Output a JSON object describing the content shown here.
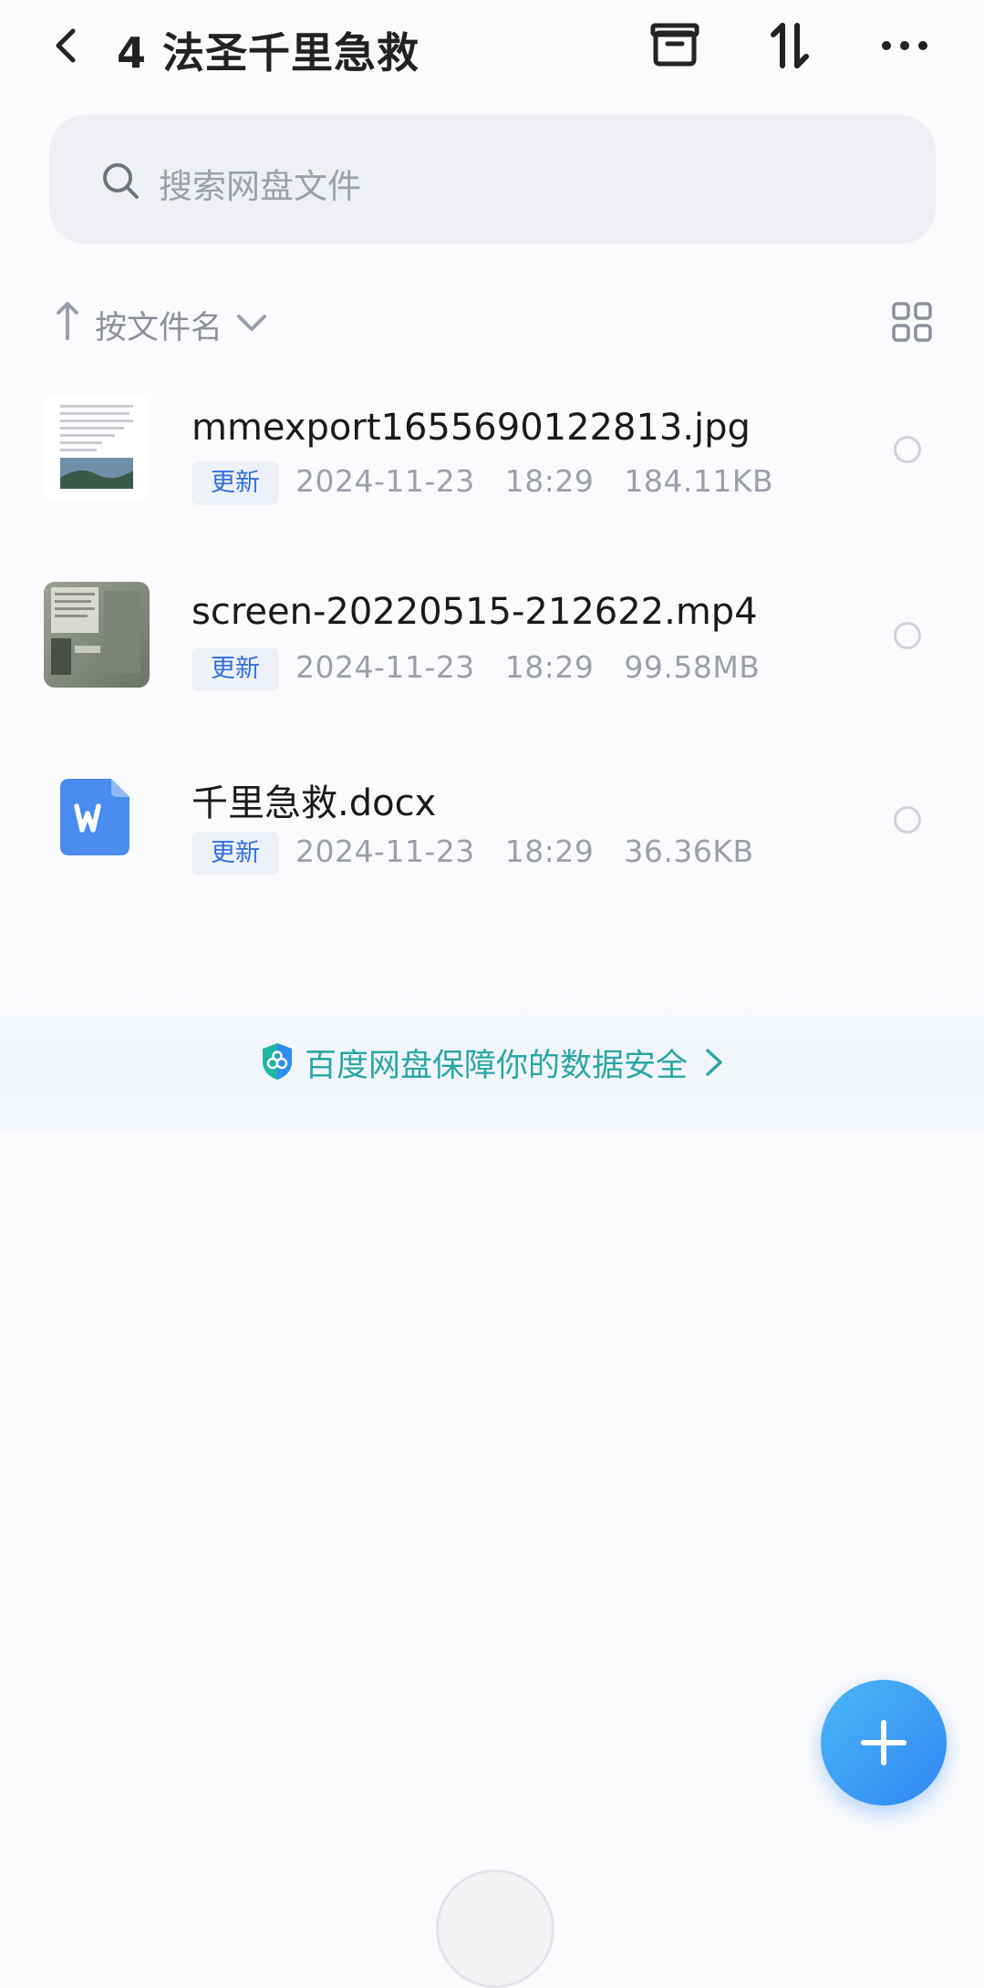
{
  "header": {
    "title": "4 法圣千里急救",
    "icons": [
      "back-icon",
      "archive-icon",
      "sort-icon",
      "more-icon"
    ]
  },
  "search": {
    "placeholder": "搜索网盘文件"
  },
  "sort": {
    "label": "按文件名",
    "icons": [
      "sort-arrow-up-icon",
      "chevron-down-icon",
      "grid-view-icon"
    ]
  },
  "files": [
    {
      "name": "mmexport1655690122813.jpg",
      "tag": "更新",
      "date": "2024-11-23",
      "time": "18:29",
      "size": "184.11KB",
      "type": "image"
    },
    {
      "name": "screen-20220515-212622.mp4",
      "tag": "更新",
      "date": "2024-11-23",
      "time": "18:29",
      "size": "99.58MB",
      "type": "video"
    },
    {
      "name": "千里急救.docx",
      "tag": "更新",
      "date": "2024-11-23",
      "time": "18:29",
      "size": "36.36KB",
      "type": "word"
    }
  ],
  "security": {
    "text": "百度网盘保障你的数据安全",
    "icon": "shield-icon"
  },
  "colors": {
    "accent": "#2f86f2",
    "security": "#2aa6a6",
    "tag_text": "#2f6fe0",
    "word_icon": "#4a8bf0"
  }
}
